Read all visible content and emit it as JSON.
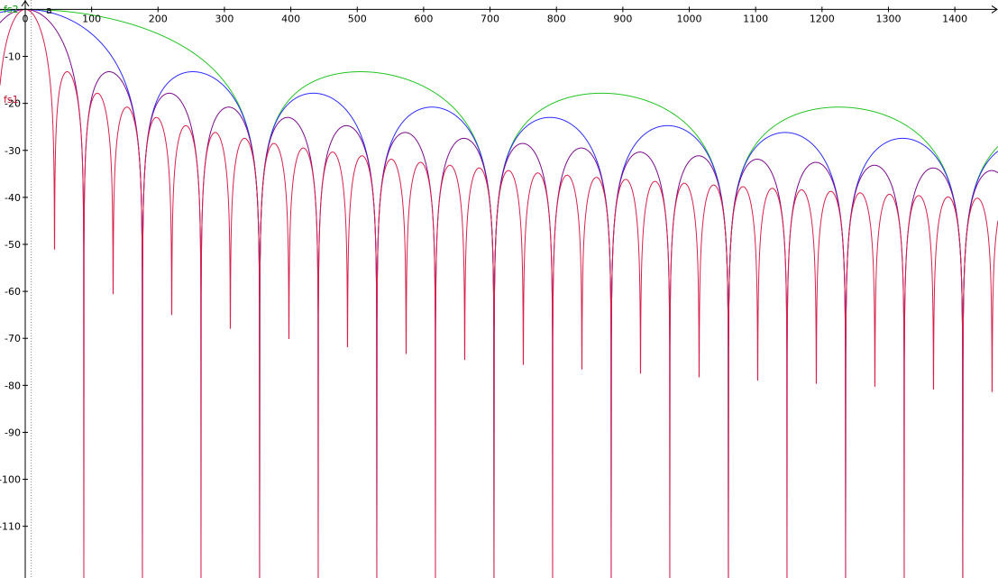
{
  "chart_data": {
    "type": "line",
    "title": "",
    "xlabel": "",
    "ylabel": "",
    "xlim": [
      -38,
      1465
    ],
    "ylim": [
      -121,
      2
    ],
    "x_ticks": [
      0,
      100,
      200,
      300,
      400,
      500,
      600,
      700,
      800,
      900,
      1000,
      1100,
      1200,
      1300,
      1400
    ],
    "y_ticks": [
      -10,
      -20,
      -30,
      -40,
      -50,
      -60,
      -70,
      -80,
      -90,
      -100,
      -110
    ],
    "grid": false,
    "function_labels": [
      {
        "id": "fs2",
        "text": "fs2",
        "color": "#00a000"
      },
      {
        "id": "fs1",
        "text": "fs1",
        "color": "#c8102e"
      },
      {
        "id": "a",
        "text": "a",
        "color": "#000000"
      }
    ],
    "marker_x": 9,
    "series": [
      {
        "color": "#22c422",
        "null_spacing": 353,
        "floor": -121
      },
      {
        "color": "#2b2bff",
        "null_spacing": 176.5,
        "floor": -121
      },
      {
        "color": "#7a0a8c",
        "null_spacing": 88.25,
        "floor": -121
      },
      {
        "color": "#d8204a",
        "null_spacing": 44.125,
        "floor": -121
      }
    ]
  }
}
